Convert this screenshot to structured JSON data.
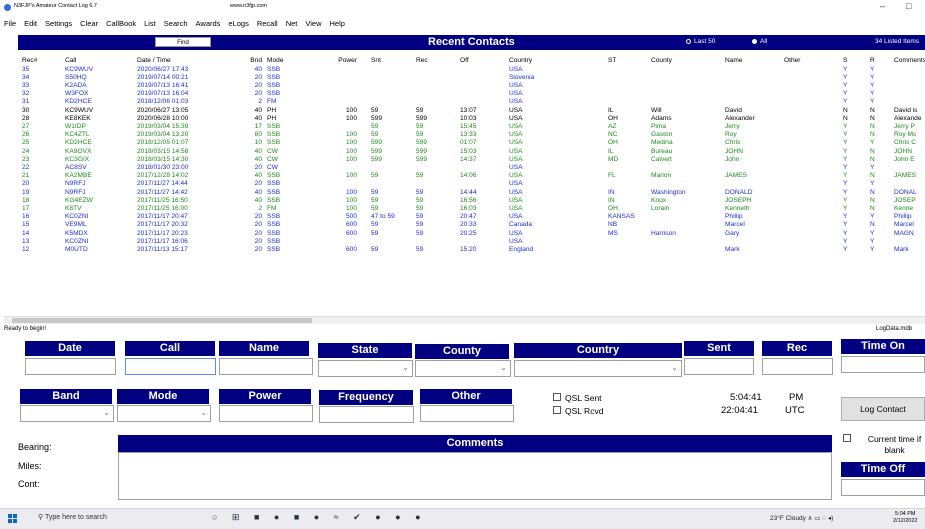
{
  "window": {
    "title": "N3FJP's Amateur Contact Log 6.7",
    "url": "www.n3fjp.com",
    "minimize": "–",
    "maximize": "□"
  },
  "menu": [
    "File",
    "Edit",
    "Settings",
    "Clear",
    "CallBook",
    "List",
    "Search",
    "Awards",
    "eLogs",
    "Recall",
    "Net",
    "View",
    "Help"
  ],
  "toolbar": {
    "find_label": "Find",
    "title": "Recent Contacts",
    "last50_label": "Last 50",
    "all_label": "All",
    "listed_text": "34 Listed Items"
  },
  "grid": {
    "headers": [
      "Rec#",
      "Call",
      "Date  /  Time",
      "Bnd",
      "Mode",
      "Power",
      "Snt",
      "Rec",
      "Off",
      "Country",
      "ST",
      "County",
      "Name",
      "Other",
      "S",
      "R",
      "Comments"
    ],
    "rows": [
      {
        "c": "b",
        "v": [
          "35",
          "KC9WUV",
          "2020/06/27  17:43",
          "40",
          "SSB",
          "",
          "",
          "",
          "",
          "USA",
          "",
          "",
          "",
          "",
          "Y",
          "Y",
          ""
        ]
      },
      {
        "c": "b",
        "v": [
          "34",
          "S50HQ",
          "2019/07/14  00:21",
          "20",
          "SSB",
          "",
          "",
          "",
          "",
          "Slovenia",
          "",
          "",
          "",
          "",
          "Y",
          "Y",
          ""
        ]
      },
      {
        "c": "b",
        "v": [
          "33",
          "K2ADA",
          "2019/07/13  16:41",
          "20",
          "SSB",
          "",
          "",
          "",
          "",
          "USA",
          "",
          "",
          "",
          "",
          "Y",
          "Y",
          ""
        ]
      },
      {
        "c": "b",
        "v": [
          "32",
          "W3FOX",
          "2019/07/13  16:04",
          "20",
          "SSB",
          "",
          "",
          "",
          "",
          "USA",
          "",
          "",
          "",
          "",
          "Y",
          "Y",
          ""
        ]
      },
      {
        "c": "b",
        "v": [
          "31",
          "KD2HCE",
          "2018/12/06  01:03",
          "2",
          "FM",
          "",
          "",
          "",
          "",
          "USA",
          "",
          "",
          "",
          "",
          "Y",
          "Y",
          ""
        ]
      },
      {
        "c": "k",
        "v": [
          "30",
          "KC9WUV",
          "2020/06/27  13:05",
          "40",
          "PH",
          "100",
          "59",
          "59",
          "13:07",
          "USA",
          "IL",
          "Will",
          "David",
          "",
          "N",
          "N",
          "David is"
        ]
      },
      {
        "c": "k",
        "v": [
          "28",
          "KE8KEK",
          "2020/06/28  10:00",
          "40",
          "PH",
          "100",
          "599",
          "599",
          "10:03",
          "USA",
          "OH",
          "Adams",
          "Alexander",
          "",
          "N",
          "N",
          "Alexande"
        ]
      },
      {
        "c": "g",
        "v": [
          "27",
          "W1IDP",
          "2019/03/04  15:39",
          "17",
          "SSB",
          "",
          "59",
          "59",
          "15:45",
          "USA",
          "AZ",
          "Pima",
          "Jerry",
          "",
          "Y",
          "N",
          "Jerry P"
        ]
      },
      {
        "c": "g",
        "v": [
          "26",
          "KC4ZTL",
          "2019/03/04  13:20",
          "80",
          "SSB",
          "100",
          "59",
          "59",
          "13:33",
          "USA",
          "NC",
          "Gaston",
          "Roy",
          "",
          "Y",
          "N",
          "Roy Mc"
        ]
      },
      {
        "c": "g",
        "v": [
          "25",
          "KD2HCE",
          "2018/12/05  01:07",
          "10",
          "SSB",
          "100",
          "599",
          "599",
          "01:07",
          "USA",
          "OH",
          "Medina",
          "Chris",
          "",
          "Y",
          "Y",
          "Chris C"
        ]
      },
      {
        "c": "g",
        "v": [
          "24",
          "KA9OVX",
          "2018/03/15  14:58",
          "40",
          "CW",
          "100",
          "599",
          "599",
          "15:03",
          "USA",
          "IL",
          "Bureau",
          "JOHN",
          "",
          "Y",
          "N",
          "JOHN"
        ]
      },
      {
        "c": "g",
        "v": [
          "23",
          "KC3GIX",
          "2018/03/15  14:30",
          "40",
          "CW",
          "100",
          "599",
          "599",
          "14:37",
          "USA",
          "MD",
          "Calvert",
          "John",
          "",
          "Y",
          "N",
          "John E"
        ]
      },
      {
        "c": "b",
        "v": [
          "22",
          "AC8SV",
          "2018/01/30  23:00",
          "20",
          "CW",
          "",
          "",
          "",
          "",
          "USA",
          "",
          "",
          "",
          "",
          "Y",
          "Y",
          ""
        ]
      },
      {
        "c": "g",
        "v": [
          "21",
          "KA2MBE",
          "2017/12/28  14:02",
          "40",
          "SSB",
          "100",
          "59",
          "59",
          "14:06",
          "USA",
          "FL",
          "Marion",
          "JAMES",
          "",
          "Y",
          "N",
          "JAMES"
        ]
      },
      {
        "c": "b",
        "v": [
          "20",
          "N9RFJ",
          "2017/11/27  14:44",
          "20",
          "SSB",
          "",
          "",
          "",
          "",
          "USA",
          "",
          "",
          "",
          "",
          "Y",
          "Y",
          ""
        ]
      },
      {
        "c": "b",
        "v": [
          "19",
          "N9RFJ",
          "2017/11/27  14:42",
          "40",
          "SSB",
          "100",
          "59",
          "59",
          "14:44",
          "USA",
          "IN",
          "Washington",
          "DONALD",
          "",
          "Y",
          "N",
          "DONAL"
        ]
      },
      {
        "c": "g",
        "v": [
          "18",
          "KG4EZW",
          "2017/11/25  16:50",
          "40",
          "SSB",
          "100",
          "59",
          "59",
          "16:56",
          "USA",
          "IN",
          "Knox",
          "JOSEPH",
          "",
          "Y",
          "N",
          "JOSEP"
        ]
      },
      {
        "c": "g",
        "v": [
          "17",
          "K8TV",
          "2017/11/25  16:00",
          "2",
          "FM",
          "100",
          "59",
          "59",
          "16:03",
          "USA",
          "OH",
          "Lorain",
          "Kenneth",
          "",
          "Y",
          "N",
          "Kenne"
        ]
      },
      {
        "c": "b",
        "v": [
          "16",
          "KC0ZNI",
          "2017/11/17  20:47",
          "20",
          "SSB",
          "500",
          "47 to 59",
          "59",
          "20:47",
          "USA",
          "KANSAS",
          "",
          "Phillip",
          "",
          "Y",
          "Y",
          "Phillip"
        ]
      },
      {
        "c": "b",
        "v": [
          "15",
          "VE9ML",
          "2017/11/17  20:32",
          "20",
          "SSB",
          "600",
          "59",
          "59",
          "20:33",
          "Canada",
          "NB",
          "",
          "Marcel",
          "",
          "Y",
          "N",
          "Marcel"
        ]
      },
      {
        "c": "b",
        "v": [
          "14",
          "K5MDX",
          "2017/11/17  20:23",
          "20",
          "SSB",
          "600",
          "59",
          "59",
          "20:25",
          "USA",
          "MS",
          "Harrison",
          "Gary",
          "",
          "Y",
          "Y",
          "MAGN"
        ]
      },
      {
        "c": "b",
        "v": [
          "13",
          "KC0ZNI",
          "2017/11/17  16:06",
          "20",
          "SSB",
          "",
          "",
          "",
          "",
          "USA",
          "",
          "",
          "",
          "",
          "Y",
          "Y",
          ""
        ]
      },
      {
        "c": "b",
        "v": [
          "12",
          "M0UTD",
          "2017/11/13  15:17",
          "20",
          "SSB",
          "600",
          "59",
          "59",
          "15:20",
          "England",
          "",
          "",
          "Mark",
          "",
          "Y",
          "Y",
          "Mark"
        ]
      }
    ]
  },
  "status": {
    "ready": "Ready to begin!",
    "logdata": "LogData.mdb"
  },
  "labels": {
    "date": "Date",
    "call": "Call",
    "name": "Name",
    "state": "State",
    "county": "County",
    "country": "Country",
    "sent": "Sent",
    "rec": "Rec",
    "time_on": "Time On",
    "band": "Band",
    "mode": "Mode",
    "power": "Power",
    "frequency": "Frequency",
    "other": "Other",
    "comments": "Comments",
    "time_off": "Time Off"
  },
  "qsl": {
    "sent": "QSL Sent",
    "rcvd": "QSL Rcvd"
  },
  "clock": {
    "local_time": "5:04:41",
    "local_ampm": "PM",
    "utc_time": "22:04:41",
    "utc_label": "UTC"
  },
  "buttons": {
    "log_contact": "Log Contact"
  },
  "current_time_label": "Current time if blank",
  "side": {
    "bearing": "Bearing:",
    "miles": "Miles:",
    "cont": "Cont:"
  },
  "taskbar": {
    "search_placeholder": "Type here to search",
    "weather": "23°F  Cloudy",
    "time": "5:04 PM",
    "date": "2/12/2022"
  },
  "colors": {
    "header_blue": "#000080",
    "row_blue": "#1f2fd0",
    "row_green": "#1f8a1f",
    "row_black": "#000000"
  }
}
